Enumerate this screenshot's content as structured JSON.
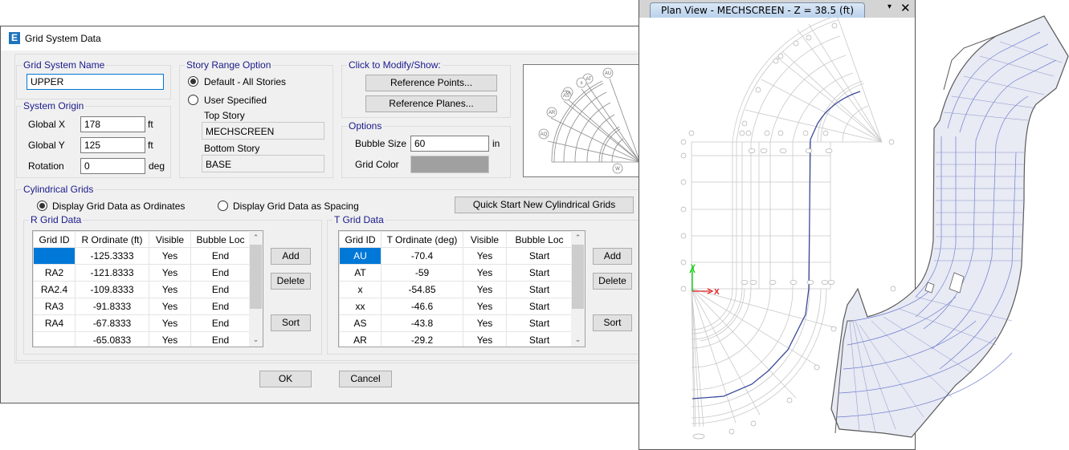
{
  "dialog": {
    "title": "Grid System Data",
    "app_icon": "E",
    "grid_system_name": {
      "label": "Grid System Name",
      "value": "UPPER"
    },
    "system_origin": {
      "label": "System Origin",
      "global_x": {
        "label": "Global  X",
        "value": "178",
        "unit": "ft"
      },
      "global_y": {
        "label": "Global  Y",
        "value": "125",
        "unit": "ft"
      },
      "rotation": {
        "label": "Rotation",
        "value": "0",
        "unit": "deg"
      }
    },
    "story_range": {
      "label": "Story Range Option",
      "default_option": "Default - All Stories",
      "user_option": "User Specified",
      "selected": "default",
      "top_story_label": "Top Story",
      "top_story_value": "MECHSCREEN",
      "bottom_story_label": "Bottom Story",
      "bottom_story_value": "BASE"
    },
    "modify_show": {
      "label": "Click to Modify/Show:",
      "reference_points": "Reference Points...",
      "reference_planes": "Reference Planes..."
    },
    "options": {
      "label": "Options",
      "bubble_size_label": "Bubble Size",
      "bubble_size_value": "60",
      "bubble_size_unit": "in",
      "grid_color_label": "Grid Color",
      "grid_color": "#a0a0a0"
    },
    "preview": {
      "bubble_labels": [
        "AU",
        "AT",
        "x",
        "xx",
        "AS",
        "AR",
        "AQ",
        "W"
      ]
    },
    "cylindrical": {
      "label": "Cylindrical Grids",
      "ordinates_option": "Display Grid Data as Ordinates",
      "spacing_option": "Display Grid Data as Spacing",
      "selected": "ordinates",
      "quick_start": "Quick Start New Cylindrical Grids"
    },
    "r_grid": {
      "label": "R Grid Data",
      "columns": [
        "Grid ID",
        "R Ordinate  (ft)",
        "Visible",
        "Bubble Loc"
      ],
      "rows": [
        [
          "",
          "-125.3333",
          "Yes",
          "End"
        ],
        [
          "RA2",
          "-121.8333",
          "Yes",
          "End"
        ],
        [
          "RA2.4",
          "-109.8333",
          "Yes",
          "End"
        ],
        [
          "RA3",
          "-91.8333",
          "Yes",
          "End"
        ],
        [
          "RA4",
          "-67.8333",
          "Yes",
          "End"
        ],
        [
          "",
          "-65.0833",
          "Yes",
          "End"
        ]
      ],
      "add": "Add",
      "delete": "Delete",
      "sort": "Sort"
    },
    "t_grid": {
      "label": "T Grid Data",
      "columns": [
        "Grid ID",
        "T Ordinate  (deg)",
        "Visible",
        "Bubble Loc"
      ],
      "rows": [
        [
          "AU",
          "-70.4",
          "Yes",
          "Start"
        ],
        [
          "AT",
          "-59",
          "Yes",
          "Start"
        ],
        [
          "x",
          "-54.85",
          "Yes",
          "Start"
        ],
        [
          "xx",
          "-46.6",
          "Yes",
          "Start"
        ],
        [
          "AS",
          "-43.8",
          "Yes",
          "Start"
        ],
        [
          "AR",
          "-29.2",
          "Yes",
          "Start"
        ]
      ],
      "add": "Add",
      "delete": "Delete",
      "sort": "Sort"
    },
    "ok": "OK",
    "cancel": "Cancel"
  },
  "plan_view": {
    "title": "Plan View - MECHSCREEN - Z = 38.5 (ft)",
    "menu_icon": "▾",
    "close_icon": "✕",
    "axis_x_label": "X",
    "axis_y_label": "Y",
    "highlight_color": "#3a4a9a"
  }
}
